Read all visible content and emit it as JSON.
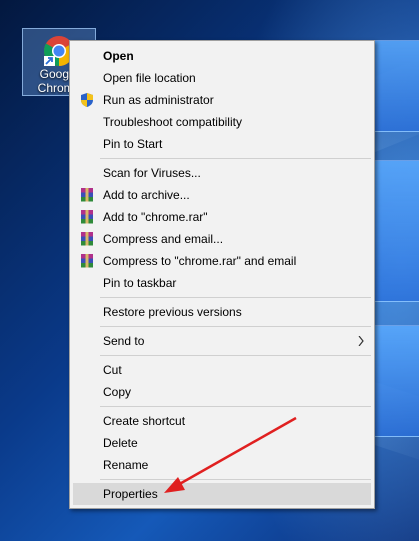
{
  "desktop": {
    "icon_label": "Google\nChrome",
    "icon_name": "chrome-icon",
    "accent": "#1a5bd0"
  },
  "menu": {
    "groups": [
      [
        {
          "label": "Open",
          "bold": true
        },
        {
          "label": "Open file location"
        },
        {
          "label": "Run as administrator",
          "icon": "uac-shield-icon"
        },
        {
          "label": "Troubleshoot compatibility"
        },
        {
          "label": "Pin to Start"
        }
      ],
      [
        {
          "label": "Scan for Viruses..."
        },
        {
          "label": "Add to archive...",
          "icon": "winrar-icon"
        },
        {
          "label": "Add to \"chrome.rar\"",
          "icon": "winrar-icon"
        },
        {
          "label": "Compress and email...",
          "icon": "winrar-icon"
        },
        {
          "label": "Compress to \"chrome.rar\" and email",
          "icon": "winrar-icon"
        },
        {
          "label": "Pin to taskbar"
        }
      ],
      [
        {
          "label": "Restore previous versions"
        }
      ],
      [
        {
          "label": "Send to",
          "submenu": true
        }
      ],
      [
        {
          "label": "Cut"
        },
        {
          "label": "Copy"
        }
      ],
      [
        {
          "label": "Create shortcut"
        },
        {
          "label": "Delete"
        },
        {
          "label": "Rename"
        }
      ],
      [
        {
          "label": "Properties",
          "highlighted": true
        }
      ]
    ]
  },
  "annotation": {
    "arrow_color": "#e02020",
    "points_to": "Properties"
  }
}
